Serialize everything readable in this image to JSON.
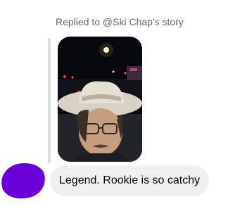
{
  "reply_context": "Replied to @Ski Chap's story",
  "story": {
    "thumbnail_icon": "story-photo-cowboy-hat-selfie"
  },
  "message": {
    "text": "Legend. Rookie is so catchy"
  },
  "colors": {
    "avatar": "#6a00d9",
    "bubble": "#f0f0f0",
    "reply_bar": "#dadde1",
    "meta_text": "#65676b"
  }
}
